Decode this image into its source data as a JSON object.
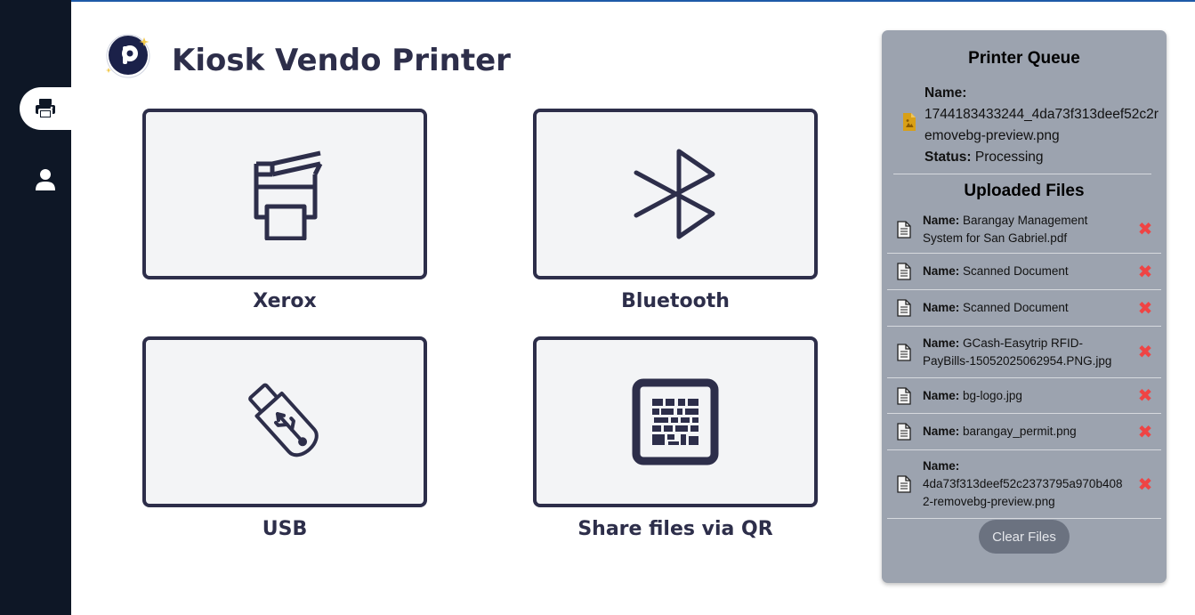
{
  "app": {
    "title": "Kiosk Vendo Printer",
    "logo_letter": "P"
  },
  "sidebar": {
    "items": [
      {
        "icon": "printer-icon",
        "active": true
      },
      {
        "icon": "user-icon",
        "active": false
      }
    ]
  },
  "tiles": [
    {
      "label": "Xerox",
      "icon": "printer-icon"
    },
    {
      "label": "Bluetooth",
      "icon": "bluetooth-icon"
    },
    {
      "label": "USB",
      "icon": "usb-drive-icon"
    },
    {
      "label": "Share files via QR",
      "icon": "qr-code-icon"
    }
  ],
  "queue": {
    "heading": "Printer Queue",
    "name_label": "Name:",
    "name_value": "1744183433244_4da73f313deef52c2removebg-preview.png",
    "status_label": "Status:",
    "status_value": "Processing"
  },
  "uploads": {
    "heading": "Uploaded Files",
    "name_label": "Name:",
    "files": [
      {
        "name": "Barangay Management System for San Gabriel.pdf"
      },
      {
        "name": "Scanned Document"
      },
      {
        "name": "Scanned Document"
      },
      {
        "name": "GCash-Easytrip RFID-PayBills-15052025062954.PNG.jpg"
      },
      {
        "name": "bg-logo.jpg"
      },
      {
        "name": "barangay_permit.png"
      },
      {
        "name": "4da73f313deef52c2373795a970b4082-removebg-preview.png"
      }
    ],
    "remove_symbol": "✖",
    "clear_label": "Clear Files"
  },
  "colors": {
    "sidebar_bg": "#0e1726",
    "accent_dark": "#2d2e4a",
    "panel_bg": "#9ca3af",
    "remove_red": "#ef4444",
    "file_icon_yellow": "#d9a016"
  }
}
